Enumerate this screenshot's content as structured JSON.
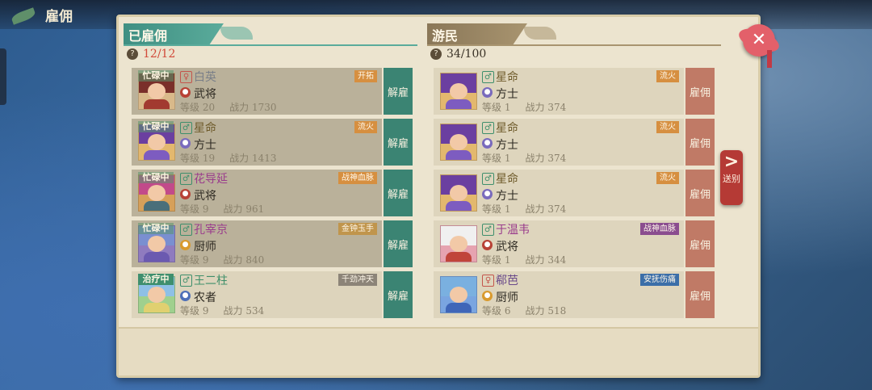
{
  "page": {
    "title": "雇佣"
  },
  "hired": {
    "header": "已雇佣",
    "count": "12/12",
    "action_label": "解雇",
    "items": [
      {
        "status": "忙碌中",
        "gender": "female",
        "name": "白英",
        "name_color": "#7a7f88",
        "class": "武将",
        "class_icon": "general-icon",
        "level_label": "等级",
        "level": "20",
        "power_label": "战力",
        "power": "1730",
        "trait": "开拓",
        "trait_color": "orange"
      },
      {
        "status": "忙碌中",
        "gender": "male",
        "name": "星命",
        "name_color": "#6e5a2a",
        "class": "方士",
        "class_icon": "mage-icon",
        "level_label": "等级",
        "level": "19",
        "power_label": "战力",
        "power": "1413",
        "trait": "流火",
        "trait_color": "orange"
      },
      {
        "status": "忙碌中",
        "gender": "male",
        "name": "花导延",
        "name_color": "#9a3c8c",
        "class": "武将",
        "class_icon": "general-icon",
        "level_label": "等级",
        "level": "9",
        "power_label": "战力",
        "power": "961",
        "trait": "战神血脉",
        "trait_color": "orange"
      },
      {
        "status": "忙碌中",
        "gender": "male",
        "name": "孔宰京",
        "name_color": "#9a3c8c",
        "class": "厨师",
        "class_icon": "cook-icon",
        "level_label": "等级",
        "level": "9",
        "power_label": "战力",
        "power": "840",
        "trait": "金钟玉手",
        "trait_color": "gold"
      },
      {
        "status": "治疗中",
        "gender": "male",
        "name": "王二柱",
        "name_color": "#3f8f6a",
        "class": "农者",
        "class_icon": "farmer-icon",
        "level_label": "等级",
        "level": "9",
        "power_label": "战力",
        "power": "534",
        "trait": "千劲冲天",
        "trait_color": "gray"
      }
    ]
  },
  "wanderers": {
    "header": "游民",
    "count": "34/100",
    "action_label": "雇佣",
    "items": [
      {
        "gender": "male",
        "name": "星命",
        "name_color": "#6e5a2a",
        "class": "方士",
        "class_icon": "mage-icon",
        "level_label": "等级",
        "level": "1",
        "power_label": "战力",
        "power": "374",
        "trait": "流火",
        "trait_color": "orange"
      },
      {
        "gender": "male",
        "name": "星命",
        "name_color": "#6e5a2a",
        "class": "方士",
        "class_icon": "mage-icon",
        "level_label": "等级",
        "level": "1",
        "power_label": "战力",
        "power": "374",
        "trait": "流火",
        "trait_color": "orange"
      },
      {
        "gender": "male",
        "name": "星命",
        "name_color": "#6e5a2a",
        "class": "方士",
        "class_icon": "mage-icon",
        "level_label": "等级",
        "level": "1",
        "power_label": "战力",
        "power": "374",
        "trait": "流火",
        "trait_color": "orange"
      },
      {
        "gender": "male",
        "name": "于温韦",
        "name_color": "#9a3c8c",
        "class": "武将",
        "class_icon": "general-icon",
        "level_label": "等级",
        "level": "1",
        "power_label": "战力",
        "power": "344",
        "trait": "战神血脉",
        "trait_color": "purple"
      },
      {
        "gender": "female",
        "name": "郗芭",
        "name_color": "#6a4a8a",
        "class": "厨师",
        "class_icon": "cook-icon",
        "level_label": "等级",
        "level": "6",
        "power_label": "战力",
        "power": "518",
        "trait": "安抚伤痛",
        "trait_color": "blue"
      }
    ]
  },
  "send_off": {
    "label": "送别",
    "arrow": ">"
  },
  "close": {
    "glyph": "✕"
  },
  "colors": {
    "hired_accent": "#3b8473",
    "wanderer_accent": "#c07a66",
    "panel_bg": "#ece4cf"
  }
}
